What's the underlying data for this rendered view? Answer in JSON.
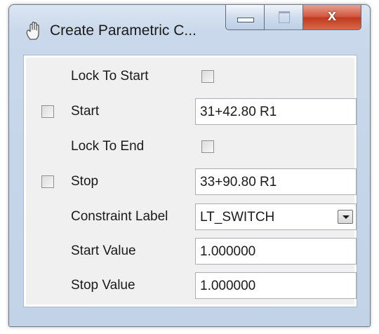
{
  "window": {
    "title": "Create Parametric C...",
    "close_glyph": "x",
    "icon": "pan-hand-icon"
  },
  "form": {
    "lock_to_start": {
      "label": "Lock To Start",
      "checked": false
    },
    "start": {
      "label": "Start",
      "checked": false,
      "value": "31+42.80 R1"
    },
    "lock_to_end": {
      "label": "Lock To End",
      "checked": false
    },
    "stop": {
      "label": "Stop",
      "checked": false,
      "value": "33+90.80 R1"
    },
    "constraint_label": {
      "label": "Constraint Label",
      "selected": "LT_SWITCH"
    },
    "start_value": {
      "label": "Start Value",
      "value": "1.000000"
    },
    "stop_value": {
      "label": "Stop Value",
      "value": "1.000000"
    }
  }
}
